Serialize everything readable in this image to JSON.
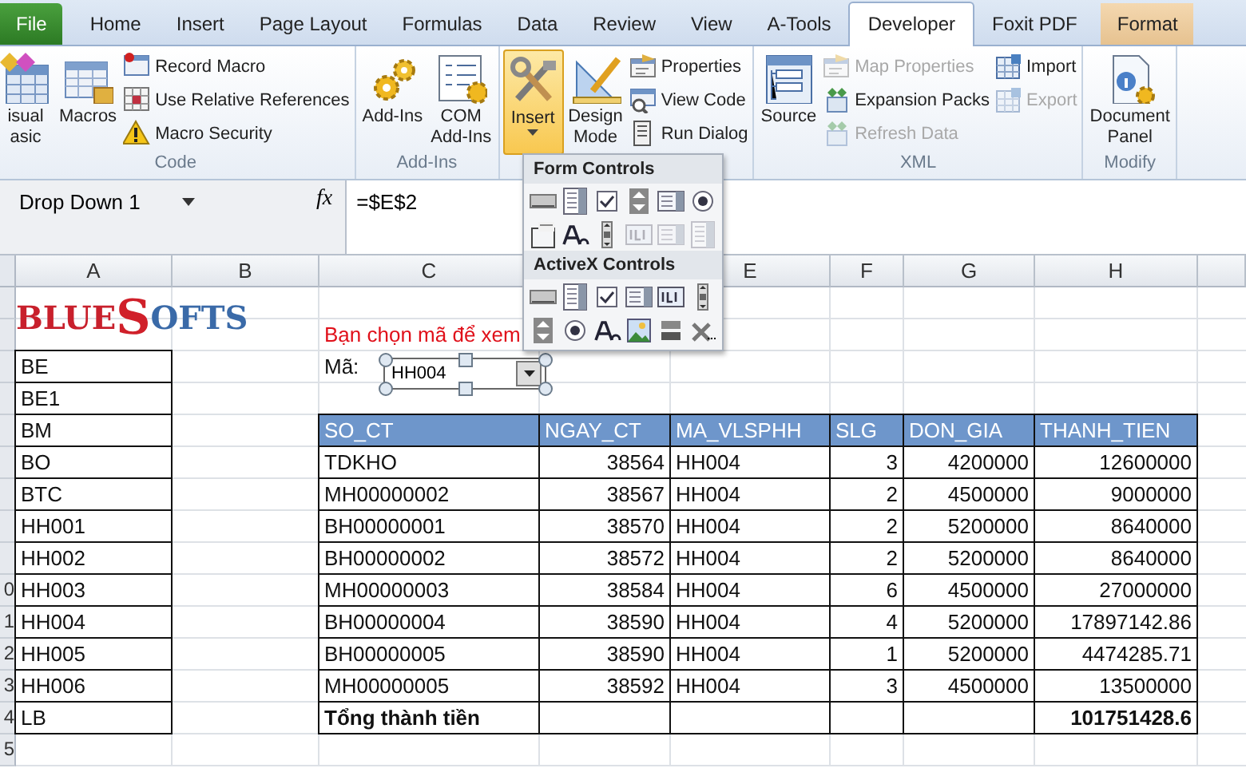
{
  "ribbon_tabs": [
    {
      "label": "File",
      "kind": "file",
      "selected": false
    },
    {
      "label": "Home",
      "kind": "normal",
      "selected": false
    },
    {
      "label": "Insert",
      "kind": "normal",
      "selected": false
    },
    {
      "label": "Page Layout",
      "kind": "normal",
      "selected": false
    },
    {
      "label": "Formulas",
      "kind": "normal",
      "selected": false
    },
    {
      "label": "Data",
      "kind": "normal",
      "selected": false
    },
    {
      "label": "Review",
      "kind": "normal",
      "selected": false
    },
    {
      "label": "View",
      "kind": "normal",
      "selected": false
    },
    {
      "label": "A-Tools",
      "kind": "normal",
      "selected": false
    },
    {
      "label": "Developer",
      "kind": "normal",
      "selected": true
    },
    {
      "label": "Foxit PDF",
      "kind": "normal",
      "selected": false
    },
    {
      "label": "Format",
      "kind": "contextual",
      "selected": false
    }
  ],
  "ribbon_groups": [
    {
      "label": "Code",
      "columns": [
        [
          {
            "label": "isual\nasic",
            "kind": "large",
            "disabled": false,
            "active": false
          }
        ],
        [
          {
            "label": "Macros",
            "kind": "large",
            "disabled": false,
            "active": false
          }
        ],
        [
          {
            "label": "Record Macro",
            "kind": "small",
            "disabled": false,
            "active": false
          },
          {
            "label": "Use Relative References",
            "kind": "small",
            "disabled": false,
            "active": false
          },
          {
            "label": "Macro Security",
            "kind": "small",
            "disabled": false,
            "active": false
          }
        ]
      ]
    },
    {
      "label": "Add-Ins",
      "columns": [
        [
          {
            "label": "Add-Ins",
            "kind": "large",
            "disabled": false,
            "active": false
          }
        ],
        [
          {
            "label": "COM\nAdd-Ins",
            "kind": "large",
            "disabled": false,
            "active": false
          }
        ]
      ]
    },
    {
      "columns": [
        [
          {
            "label": "Insert",
            "kind": "large",
            "disabled": false,
            "active": true
          }
        ],
        [
          {
            "label": "Design\nMode",
            "kind": "large",
            "disabled": false,
            "active": false
          }
        ],
        [
          {
            "label": "Properties",
            "kind": "small",
            "disabled": false,
            "active": false
          },
          {
            "label": "View Code",
            "kind": "small",
            "disabled": false,
            "active": false
          },
          {
            "label": "Run Dialog",
            "kind": "small",
            "disabled": false,
            "active": false
          }
        ]
      ]
    },
    {
      "label": "XML",
      "columns": [
        [
          {
            "label": "Source",
            "kind": "large",
            "disabled": false,
            "active": false
          }
        ],
        [
          {
            "label": "Map Properties",
            "kind": "small",
            "disabled": true,
            "active": false
          },
          {
            "label": "Expansion Packs",
            "kind": "small",
            "disabled": false,
            "active": false
          },
          {
            "label": "Refresh Data",
            "kind": "small",
            "disabled": true,
            "active": false
          }
        ],
        [
          {
            "label": "Import",
            "kind": "small",
            "disabled": false,
            "active": false
          },
          {
            "label": "Export",
            "kind": "small",
            "disabled": true,
            "active": false
          }
        ]
      ]
    },
    {
      "label": "Modify",
      "columns": [
        [
          {
            "label": "Document\nPanel",
            "kind": "large",
            "disabled": false,
            "active": false
          }
        ]
      ]
    }
  ],
  "name_box": "Drop Down 1",
  "fx": "fx",
  "formula": "=$E$2",
  "insert_menu": [
    {
      "title": "Form Controls",
      "rows": [
        [
          {
            "kind": "button",
            "disabled": false
          },
          {
            "kind": "combo",
            "disabled": false
          },
          {
            "kind": "check",
            "disabled": false
          },
          {
            "kind": "spin",
            "disabled": false
          },
          {
            "kind": "list",
            "disabled": false
          },
          {
            "kind": "radio",
            "disabled": false
          }
        ],
        [
          {
            "kind": "group",
            "disabled": false
          },
          {
            "kind": "label",
            "disabled": false
          },
          {
            "kind": "scroll",
            "disabled": false
          },
          {
            "kind": "textbox",
            "disabled": true
          },
          {
            "kind": "list",
            "disabled": true
          },
          {
            "kind": "combo",
            "disabled": true
          }
        ]
      ]
    },
    {
      "title": "ActiveX Controls",
      "rows": [
        [
          {
            "kind": "button",
            "disabled": false
          },
          {
            "kind": "combo",
            "disabled": false
          },
          {
            "kind": "check",
            "disabled": false
          },
          {
            "kind": "list",
            "disabled": false
          },
          {
            "kind": "textbox",
            "disabled": false
          },
          {
            "kind": "scroll",
            "disabled": false
          }
        ],
        [
          {
            "kind": "spin",
            "disabled": false
          },
          {
            "kind": "radio",
            "disabled": false
          },
          {
            "kind": "label",
            "disabled": false
          },
          {
            "kind": "image",
            "disabled": false
          },
          {
            "kind": "toggle",
            "disabled": false
          },
          {
            "kind": "more",
            "disabled": false
          }
        ]
      ]
    }
  ],
  "sheet": {
    "columns": [
      "A",
      "B",
      "C",
      "E",
      "F",
      "G",
      "H"
    ],
    "row_numbers": [
      "0",
      "1",
      "2",
      "3",
      "4",
      "5"
    ]
  },
  "logo": [
    {
      "text": "BLU",
      "color": "#c8202c"
    },
    {
      "text": "E",
      "color": "#c8202c"
    },
    {
      "text": "S",
      "color": "#d0202a"
    },
    {
      "text": "OFTS",
      "color": "#3a6aa8"
    }
  ],
  "prompt": "Bạn chọn mã để xem",
  "code_label": "Mã:",
  "dropdown": {
    "value": "HH004"
  },
  "code_list": [
    "BE",
    "BE1",
    "BM",
    "BO",
    "BTC",
    "HH001",
    "HH002",
    "HH003",
    "HH004",
    "HH005",
    "HH006",
    "LB"
  ],
  "table": {
    "columns": [
      "SO_CT",
      "NGAY_CT",
      "MA_VLSPHH",
      "SLG",
      "DON_GIA",
      "THANH_TIEN"
    ],
    "rows": [
      [
        "TDKHO",
        "38564",
        "HH004",
        "3",
        "4200000",
        "12600000"
      ],
      [
        "MH00000002",
        "38567",
        "HH004",
        "2",
        "4500000",
        "9000000"
      ],
      [
        "BH00000001",
        "38570",
        "HH004",
        "2",
        "5200000",
        "8640000"
      ],
      [
        "BH00000002",
        "38572",
        "HH004",
        "2",
        "5200000",
        "8640000"
      ],
      [
        "MH00000003",
        "38584",
        "HH004",
        "6",
        "4500000",
        "27000000"
      ],
      [
        "BH00000004",
        "38590",
        "HH004",
        "4",
        "5200000",
        "17897142.86"
      ],
      [
        "BH00000005",
        "38590",
        "HH004",
        "1",
        "5200000",
        "4474285.71"
      ],
      [
        "MH00000005",
        "38592",
        "HH004",
        "3",
        "4500000",
        "13500000"
      ]
    ],
    "total_label": "Tổng thành tiền",
    "total": "101751428.6"
  }
}
